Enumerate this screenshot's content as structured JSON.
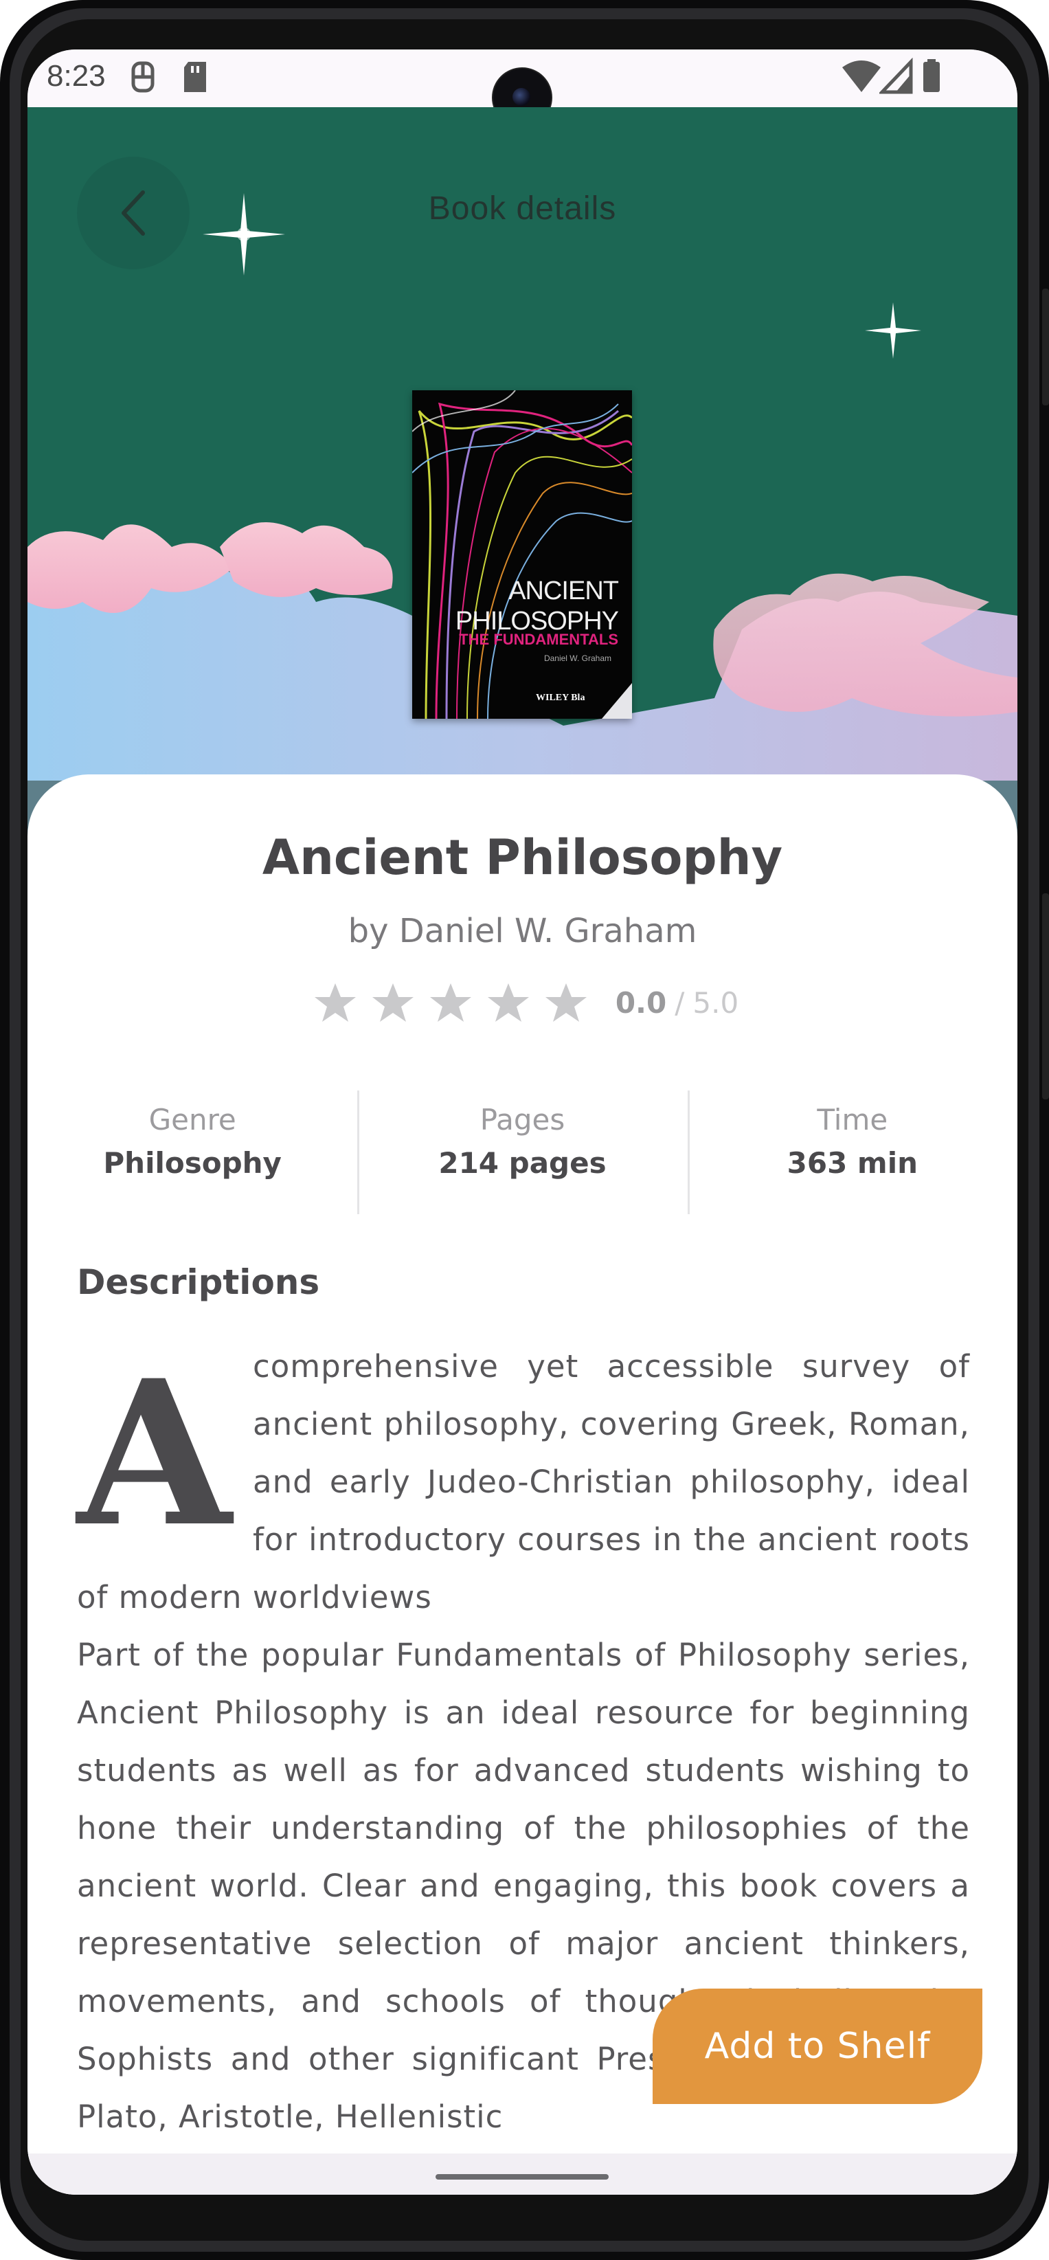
{
  "status_bar": {
    "time": "8:23"
  },
  "header": {
    "title": "Book details"
  },
  "book": {
    "cover": {
      "title_line1": "ANCIENT",
      "title_line2": "PHILOSOPHY",
      "subtitle": "THE FUNDAMENTALS",
      "author": "Daniel W. Graham",
      "publisher": "WILEY Bla"
    },
    "title": "Ancient Philosophy",
    "author": "by Daniel W. Graham",
    "rating": {
      "value": "0.0",
      "separator": "/",
      "max": "5.0",
      "stars_filled": 0,
      "stars_total": 5
    },
    "stats": {
      "genre_label": "Genre",
      "genre_value": "Philosophy",
      "pages_label": "Pages",
      "pages_value": "214 pages",
      "time_label": "Time",
      "time_value": "363 min"
    }
  },
  "description": {
    "heading": "Descriptions",
    "dropcap": "A",
    "paragraph1": "comprehensive yet accessible survey of ancient philosophy, covering Greek, Roman, and early Judeo-Christian philosophy, ideal for introductory courses in the ancient roots of modern worldviews",
    "paragraph2": "Part of the popular Fundamentals of Philosophy series, Ancient Philosophy is an ideal resource for beginning students as well as for advanced students wishing to hone their understanding of the philosophies of the ancient world. Clear and engaging, this book covers a representative selection of major ancient thinkers, movements, and schools of thought, including the Sophists and other significant Presocratics, Socrates, Plato, Aristotle, Hellenistic"
  },
  "actions": {
    "add_to_shelf": "Add to Shelf"
  },
  "colors": {
    "hero_bg": "#1c6754",
    "accent": "#e2963e",
    "star_empty": "#c9c9cb"
  }
}
